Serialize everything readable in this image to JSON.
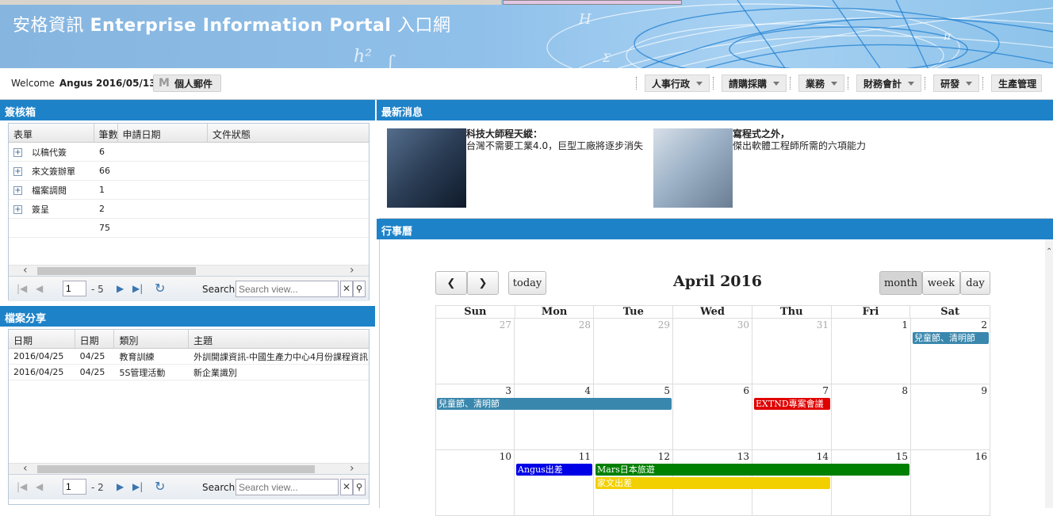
{
  "banner": {
    "title_cn": "安格資訊",
    "title_en": "Enterprise Information Portal",
    "title_suffix": "入口網"
  },
  "topbar": {
    "welcome": "Welcome",
    "user": "Angus",
    "date": "2016/05/13",
    "mail_icon": "M",
    "mail_label": "個人郵件",
    "menus": [
      "人事行政",
      "請購採購",
      "業務",
      "財務會計",
      "研發",
      "生產管理"
    ]
  },
  "approval": {
    "header": "簽核箱",
    "columns": [
      "表單",
      "筆數",
      "申請日期",
      "文件狀態"
    ],
    "rows": [
      {
        "name": "以稿代簽",
        "count": "6"
      },
      {
        "name": "來文簽辦單",
        "count": "66"
      },
      {
        "name": "檔案調閱",
        "count": "1"
      },
      {
        "name": "簽呈",
        "count": "2"
      }
    ],
    "total": "75",
    "pager": {
      "page": "1",
      "range": "- 5",
      "search_label": "Search:",
      "search_placeholder": "Search view..."
    }
  },
  "files": {
    "header": "檔案分享",
    "columns": [
      "日期",
      "日期",
      "類別",
      "主題"
    ],
    "rows": [
      {
        "date": "2016/04/25",
        "short": "04/25",
        "category": "教育訓練",
        "subject": "外訓開課資訊-中國生產力中心4月份課程資訊"
      },
      {
        "date": "2016/04/25",
        "short": "04/25",
        "category": "5S管理活動",
        "subject": "新企業識別"
      }
    ],
    "pager": {
      "page": "1",
      "range": "- 2",
      "search_label": "Search:",
      "search_placeholder": "Search view..."
    }
  },
  "news": {
    "header": "最新消息",
    "items": [
      {
        "title": "科技大師程天縱：",
        "subtitle": "台灣不需要工業4.0，巨型工廠將逐步消失"
      },
      {
        "title": "寫程式之外，",
        "subtitle": "傑出軟體工程師所需的六項能力"
      }
    ]
  },
  "calendar": {
    "header": "行事曆",
    "today_label": "today",
    "title": "April 2016",
    "views": [
      "month",
      "week",
      "day"
    ],
    "active_view": "month",
    "dow": [
      "Sun",
      "Mon",
      "Tue",
      "Wed",
      "Thu",
      "Fri",
      "Sat"
    ],
    "weeks": [
      [
        "27",
        "28",
        "29",
        "30",
        "31",
        "1",
        "2"
      ],
      [
        "3",
        "4",
        "5",
        "6",
        "7",
        "8",
        "9"
      ],
      [
        "10",
        "11",
        "12",
        "13",
        "14",
        "15",
        "16"
      ]
    ],
    "events": [
      {
        "label": "兒童節、清明節",
        "week": 0,
        "start": 6,
        "span": 1,
        "row": 0,
        "color": "#3a87ad"
      },
      {
        "label": "兒童節、清明節",
        "week": 1,
        "start": 0,
        "span": 3,
        "row": 0,
        "color": "#3a87ad"
      },
      {
        "label": "EXTND專案會議",
        "week": 1,
        "start": 4,
        "span": 1,
        "row": 0,
        "color": "#e00000"
      },
      {
        "label": "Angus出差",
        "week": 2,
        "start": 1,
        "span": 1,
        "row": 0,
        "color": "#0000e6"
      },
      {
        "label": "Mars日本旅遊",
        "week": 2,
        "start": 2,
        "span": 4,
        "row": 0,
        "color": "#008000"
      },
      {
        "label": "家文出差",
        "week": 2,
        "start": 2,
        "span": 3,
        "row": 1,
        "color": "#f2d000"
      }
    ]
  }
}
